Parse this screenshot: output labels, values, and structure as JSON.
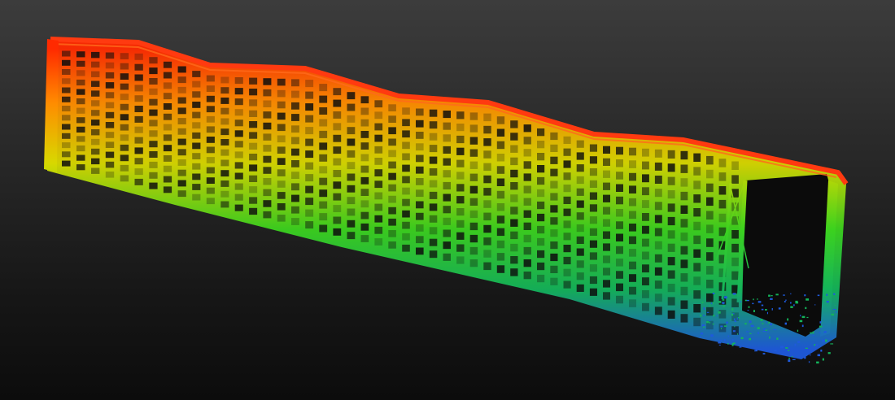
{
  "viewer": {
    "background_top": "#3c3c3c",
    "background_bottom": "#0c0c0c"
  },
  "point_cloud": {
    "subject": "building-facade-scan",
    "colormap": "height-rainbow",
    "colors": {
      "top": "#ff2a00",
      "upper": "#ff8c00",
      "mid_upper": "#d8d800",
      "mid": "#3cd21e",
      "lower": "#14b45a",
      "bottom": "#1e5adc"
    },
    "features": [
      "wavy-roofline",
      "window-grid",
      "open-bay-right-end",
      "base-debris"
    ]
  }
}
